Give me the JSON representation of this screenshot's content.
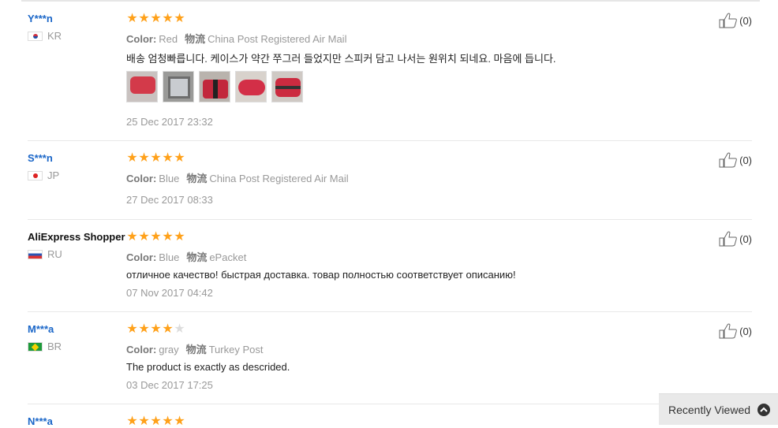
{
  "reviews": [
    {
      "name": "Y***n",
      "country": "KR",
      "flag": "kr",
      "rating": 5,
      "color_label": "Color:",
      "color": "Red",
      "shipping_label": "物流",
      "shipping": "China Post Registered Air Mail",
      "text": "배송 엄청빠릅니다. 케이스가 약간 쭈그러 들었지만 스피커 담고 나서는 원위치 되네요. 마음에 듭니다.",
      "date": "25 Dec 2017 23:32",
      "helpful": "(0)",
      "photo_count": 5
    },
    {
      "name": "S***n",
      "country": "JP",
      "flag": "jp",
      "rating": 5,
      "color_label": "Color:",
      "color": "Blue",
      "shipping_label": "物流",
      "shipping": "China Post Registered Air Mail",
      "text": "",
      "date": "27 Dec 2017 08:33",
      "helpful": "(0)"
    },
    {
      "name": "AliExpress Shopper",
      "country": "RU",
      "flag": "ru",
      "rating": 5,
      "color_label": "Color:",
      "color": "Blue",
      "shipping_label": "物流",
      "shipping": "ePacket",
      "text": "отличное качество! быстрая доставка. товар полностью соответствует описанию!",
      "date": "07 Nov 2017 04:42",
      "helpful": "(0)"
    },
    {
      "name": "M***a",
      "country": "BR",
      "flag": "br",
      "rating": 4,
      "color_label": "Color:",
      "color": "gray",
      "shipping_label": "物流",
      "shipping": "Turkey Post",
      "text": "The product is exactly as descrided.",
      "date": "03 Dec 2017 17:25",
      "helpful": "(0)"
    },
    {
      "name": "N***a",
      "rating": 5
    }
  ],
  "recently_viewed": {
    "label": "Recently Viewed",
    "icon": "chevron-up-icon"
  }
}
